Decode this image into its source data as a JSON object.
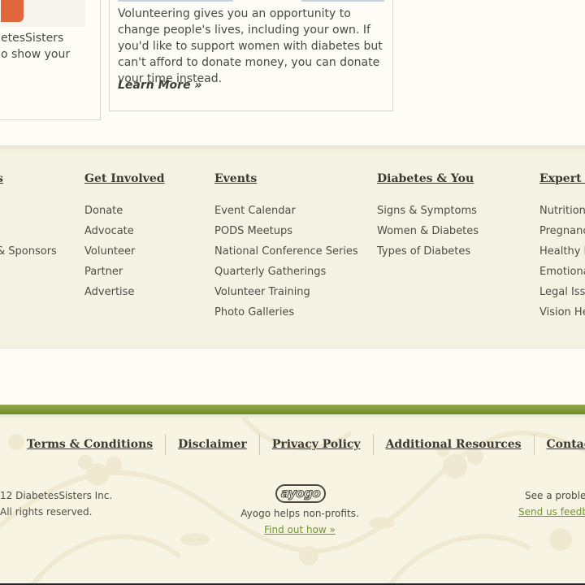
{
  "cards": {
    "left": {
      "line1": "etesSisters",
      "line2": "o show your"
    },
    "right": {
      "description": "Volunteering gives you an opportunity to change people's lives, including your own. If you'd like to support women with diabetes but can't afford to donate money, you can donate your time instead.",
      "link": "Learn More »"
    }
  },
  "nav": {
    "col0": {
      "heading": "s",
      "items": [
        "",
        "",
        "& Sponsors"
      ]
    },
    "col1": {
      "heading": "Get Involved",
      "items": [
        "Donate",
        "Advocate",
        "Volunteer",
        "Partner",
        "Advertise"
      ]
    },
    "col2": {
      "heading": "Events",
      "items": [
        "Event Calendar",
        "PODS Meetups",
        "National Conference Series",
        "Quarterly Gatherings",
        "Volunteer Training",
        "Photo Galleries"
      ]
    },
    "col3": {
      "heading": "Diabetes & You",
      "items": [
        "Signs & Symptoms",
        "Women & Diabetes",
        "Types of Diabetes"
      ]
    },
    "col4": {
      "heading": "Expert A",
      "items": [
        "Nutrition",
        "Pregnanc",
        "Healthy L",
        "Emotiona",
        "Legal Issu",
        "Vision He"
      ]
    }
  },
  "footer": {
    "links": [
      "Terms & Conditions",
      "Disclaimer",
      "Privacy Policy",
      "Additional Resources",
      "Contact Us"
    ],
    "copyright_line1": "12 DiabetesSisters Inc.",
    "copyright_line2": "All rights reserved.",
    "logo_text": "ayogo",
    "tagline": "Ayogo helps non-profits.",
    "find_out": "Find out how »",
    "problem_text": "See a probler",
    "feedback_link": "Send us feedba"
  },
  "colors": {
    "background": "#fdfcf6",
    "nav_band": "#f4f2e2",
    "accent_green": "#6c9a2a",
    "footer_bg": "#f8f4e3",
    "text": "#4a4a44"
  }
}
